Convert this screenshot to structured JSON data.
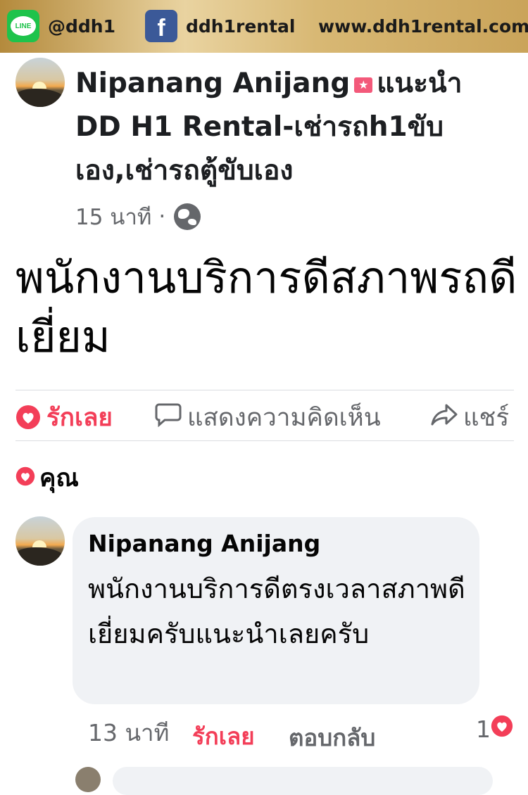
{
  "banner": {
    "line_icon_text": "LINE",
    "line_id": "@ddh1",
    "fb_icon_text": "f",
    "fb_name": "ddh1rental",
    "website": "www.ddh1rental.com"
  },
  "post": {
    "author": "Nipanang Anijang",
    "recommend_word": "แนะนำ",
    "page_name": "DD H1 Rental-เช่ารถh1ขับเอง,เช่ารถตู้ขับเอง",
    "time": "15 นาที",
    "dot": "·",
    "body": "พนักงานบริการดีสภาพรถดีเยี่ยม"
  },
  "actions": {
    "love": "รักเลย",
    "comment": "แสดงความคิดเห็น",
    "share": "แชร์"
  },
  "reactions": {
    "you": "คุณ"
  },
  "comment": {
    "author": "Nipanang Anijang",
    "text": "พนักงานบริการดีตรงเวลาสภาพดีเยี่ยมครับแนะนำเลยครับ",
    "time": "13 นาที",
    "love": "รักเลย",
    "reply": "ตอบกลับ",
    "reaction_count": "1"
  },
  "colors": {
    "love_red": "#f33e58",
    "secondary_text": "#65676b",
    "bubble_bg": "#f0f2f5",
    "banner_gold": "#d8b874"
  },
  "icons": [
    "line-icon",
    "facebook-icon",
    "star-badge-icon",
    "globe-icon",
    "heart-icon",
    "comment-icon",
    "share-icon"
  ]
}
